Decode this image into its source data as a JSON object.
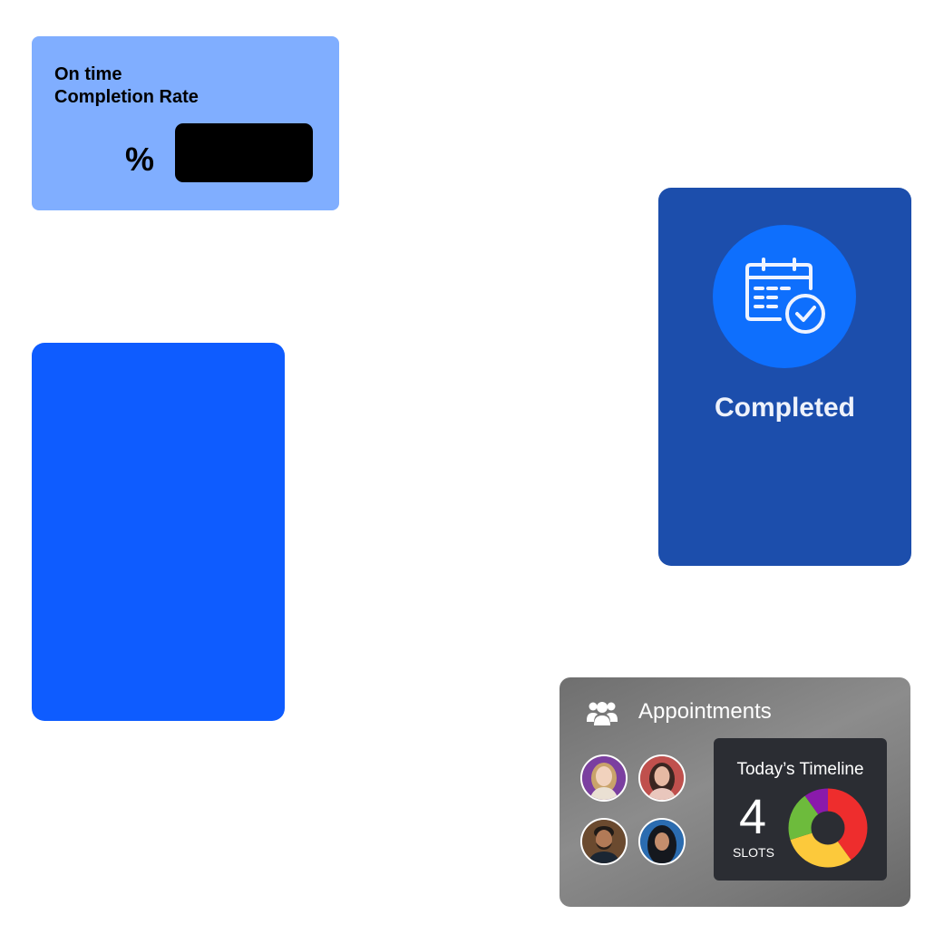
{
  "rate_card": {
    "title_line1": "On time",
    "title_line2": "Completion Rate",
    "percent_symbol": "%",
    "value": "",
    "background": "#80aeff"
  },
  "blank_card": {
    "background": "#0e5cff"
  },
  "completed_card": {
    "label": "Completed",
    "icon": "calendar-check-icon",
    "background": "#1c4eac",
    "circle_color": "#0e6ffd"
  },
  "appointments_card": {
    "title": "Appointments",
    "icon": "users-icon",
    "avatars": [
      {
        "icon": "avatar-woman-blonde",
        "bg": "#7b3fa0"
      },
      {
        "icon": "avatar-woman-brunette",
        "bg": "#c0504d"
      },
      {
        "icon": "avatar-man-beard",
        "bg": "#6b4a2f"
      },
      {
        "icon": "avatar-woman-hijab",
        "bg": "#2b6cb0"
      }
    ],
    "timeline": {
      "title": "Today’s Timeline",
      "count": "4",
      "unit": "SLOTS",
      "segment_colors": [
        "#ee2d2d",
        "#fcc93b",
        "#6dbb3c",
        "#8a1aab"
      ]
    }
  }
}
